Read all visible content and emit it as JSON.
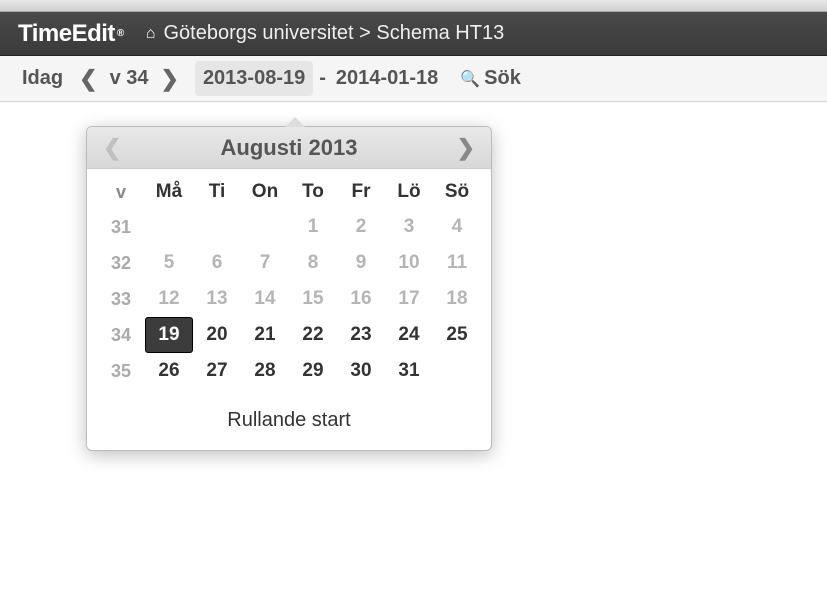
{
  "header": {
    "app_name": "TimeEdit",
    "breadcrumb_org": "Göteborgs universitet",
    "breadcrumb_sep": " > ",
    "breadcrumb_page": "Schema HT13"
  },
  "nav": {
    "today_label": "Idag",
    "week_label": "v 34",
    "date_start": "2013-08-19",
    "date_sep": "-",
    "date_end": "2014-01-18",
    "search_label": "Sök"
  },
  "calendar": {
    "title": "Augusti 2013",
    "week_header": "v",
    "day_headers": [
      "Må",
      "Ti",
      "On",
      "To",
      "Fr",
      "Lö",
      "Sö"
    ],
    "weeks": [
      {
        "wk": "31",
        "days": [
          "",
          "",
          "",
          "1",
          "2",
          "3",
          "4"
        ],
        "faded": [
          false,
          false,
          false,
          true,
          true,
          true,
          true
        ]
      },
      {
        "wk": "32",
        "days": [
          "5",
          "6",
          "7",
          "8",
          "9",
          "10",
          "11"
        ],
        "faded": [
          true,
          true,
          true,
          true,
          true,
          true,
          true
        ]
      },
      {
        "wk": "33",
        "days": [
          "12",
          "13",
          "14",
          "15",
          "16",
          "17",
          "18"
        ],
        "faded": [
          true,
          true,
          true,
          true,
          true,
          true,
          true
        ]
      },
      {
        "wk": "34",
        "days": [
          "19",
          "20",
          "21",
          "22",
          "23",
          "24",
          "25"
        ],
        "faded": [
          false,
          false,
          false,
          false,
          false,
          false,
          false
        ],
        "selected": [
          true,
          false,
          false,
          false,
          false,
          false,
          false
        ]
      },
      {
        "wk": "35",
        "days": [
          "26",
          "27",
          "28",
          "29",
          "30",
          "31",
          ""
        ],
        "faded": [
          false,
          false,
          false,
          false,
          false,
          false,
          false
        ]
      }
    ],
    "footer": "Rullande start"
  }
}
